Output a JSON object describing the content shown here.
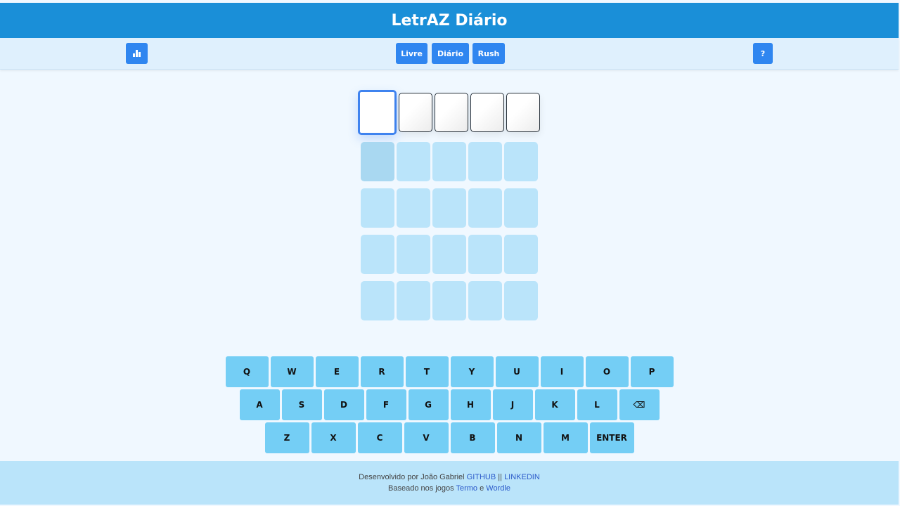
{
  "header": {
    "title": "LetrAZ Diário"
  },
  "toolbar": {
    "stats_icon": "bar-chart-icon",
    "modes": [
      "Livre",
      "Diário",
      "Rush"
    ],
    "help_label": "?"
  },
  "board": {
    "rows": 5,
    "cols": 5,
    "active_row": 0,
    "selected_col": 0,
    "letters": [
      [
        "",
        "",
        "",
        "",
        ""
      ],
      [
        "",
        "",
        "",
        "",
        ""
      ],
      [
        "",
        "",
        "",
        "",
        ""
      ],
      [
        "",
        "",
        "",
        "",
        ""
      ],
      [
        "",
        "",
        "",
        "",
        ""
      ]
    ]
  },
  "keyboard": {
    "row1": [
      "Q",
      "W",
      "E",
      "R",
      "T",
      "Y",
      "U",
      "I",
      "O",
      "P"
    ],
    "row2": [
      "A",
      "S",
      "D",
      "F",
      "G",
      "H",
      "J",
      "K",
      "L",
      "⌫"
    ],
    "row3": [
      "Z",
      "X",
      "C",
      "V",
      "B",
      "N",
      "M",
      "ENTER"
    ]
  },
  "footer": {
    "line1_text": "Desenvolvido por João Gabriel",
    "github": "GITHUB",
    "separator": "||",
    "linkedin": "LINKEDIN",
    "line2_text": "Baseado nos jogos",
    "termo": "Termo",
    "conjunction": "e",
    "wordle": "Wordle"
  },
  "colors": {
    "header_bg": "#1a8fd8",
    "button_bg": "#2f86f0",
    "key_bg": "#74cef5",
    "empty_tile": "#bae4fa",
    "selected_border": "#3f83ef",
    "link": "#2a59c9"
  }
}
